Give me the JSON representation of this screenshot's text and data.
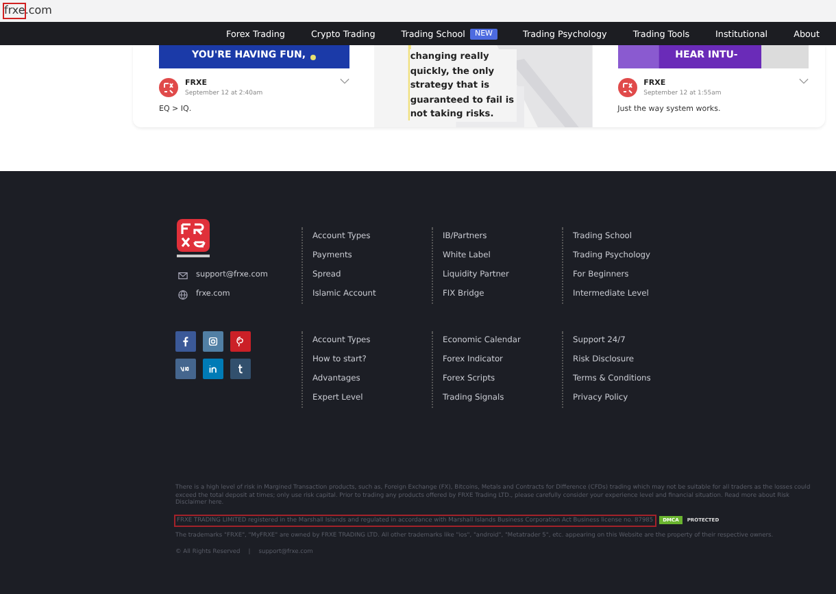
{
  "address_bar": {
    "url_parts": [
      {
        "text": "frxe",
        "highlighted": true
      },
      {
        "text": ".com",
        "highlighted": false
      }
    ]
  },
  "nav": {
    "items": [
      {
        "label": "Forex Trading"
      },
      {
        "label": "Crypto Trading"
      },
      {
        "label": "Trading School",
        "badge": "NEW"
      },
      {
        "label": "Trading Psychology"
      },
      {
        "label": "Trading Tools"
      },
      {
        "label": "Institutional"
      },
      {
        "label": "About"
      }
    ]
  },
  "posts": [
    {
      "image_text": "YOU'RE HAVING FUN,",
      "author": "FRXE",
      "date": "September 12 at 2:40am",
      "text": "EQ > IQ."
    },
    {
      "quote": "changing really quickly, the only strategy that is guaranteed to fail is not taking risks."
    },
    {
      "image_text": "HEAR INTU-",
      "author": "FRXE",
      "date": "September 12 at 1:55am",
      "text": "Just the way system works."
    }
  ],
  "footer": {
    "contacts": [
      {
        "kind": "mail",
        "text": "support@frxe.com"
      },
      {
        "kind": "web",
        "text": "frxe.com"
      }
    ],
    "socials": [
      {
        "kind": "facebook",
        "color": "#3b5998"
      },
      {
        "kind": "instagram",
        "color": "#517fa4"
      },
      {
        "kind": "pinterest",
        "color": "#cb2027"
      },
      {
        "kind": "vk",
        "color": "#45668e"
      },
      {
        "kind": "linkedin",
        "color": "#007bb6"
      },
      {
        "kind": "tumblr",
        "color": "#32506d"
      }
    ],
    "link_groups": [
      [
        [
          "Account Types",
          "Payments",
          "Spread",
          "Islamic Account"
        ],
        [
          "IB/Partners",
          "White Label",
          "Liquidity Partner",
          "FIX Bridge"
        ],
        [
          "Trading School",
          "Trading Psychology",
          "For Beginners",
          "Intermediate Level"
        ]
      ],
      [
        [
          "Account Types",
          "How to start?",
          "Advantages",
          "Expert Level"
        ],
        [
          "Economic Calendar",
          "Forex Indicator",
          "Forex Scripts",
          "Trading Signals"
        ],
        [
          "Support 24/7",
          "Risk Disclosure",
          "Terms & Conditions",
          "Privacy Policy"
        ]
      ]
    ]
  },
  "disclaimer": "There is a high level of risk in Margined Transaction products, such as, Foreign Exchange (FX), Bitcoins, Metals and Contracts for Difference (CFDs) trading which may not be suitable for all traders as the losses could exceed the total deposit at times; only use risk capital. Prior to trading any products offered by FRXE Trading LTD., please carefully consider your experience level and financial situation. Read more about Risk Disclaimer here.",
  "license": {
    "text": "FRXE TRADING LIMITED registered in the Marshall Islands and regulated in accordance with Marshall Islands Business Corporation Act Business license no. 87985",
    "highlighted": true,
    "badge": "DMCA",
    "badge_label": "PROTECTED"
  },
  "trademarks": "The trademarks \"FRXE\", \"MyFRXE\" are owned by FRXE TRADING LTD. All other trademarks like \"ios\", \"android\", \"Metatrader 5\", etc. appearing on this Website are the property of their respective owners.",
  "copyright": "© All Rights Reserved",
  "separator": "|",
  "copyright_email": "support@frxe.com"
}
